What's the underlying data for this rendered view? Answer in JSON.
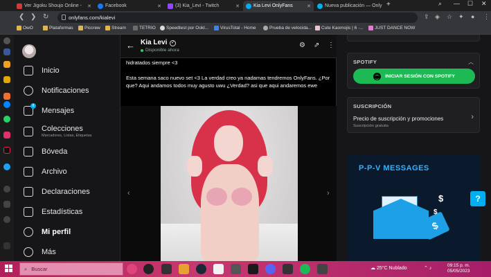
{
  "browser": {
    "tabs": [
      {
        "label": "Ver Jigoku Shoujo Online -",
        "color": "#cf3a3a"
      },
      {
        "label": "Facebook",
        "color": "#1877f2"
      },
      {
        "label": "(3) Kia_Levi - Twitch",
        "color": "#9146ff"
      },
      {
        "label": "Kia Levi OnlyFans",
        "color": "#00aff0",
        "active": true
      },
      {
        "label": "Nueva publicación — Only",
        "color": "#00aff0"
      }
    ],
    "url": "onlyfans.com/kialevi",
    "bookmarks": [
      "OwO",
      "Plataformas",
      "Piccrew",
      "Stream",
      "TETRIO",
      "Speedtest por Ookl...",
      "VirusTotal - Home",
      "Prueba de velocida...",
      "Cute Kaomojis | 6 ·...",
      "JUST DANCE NOW"
    ],
    "new_tab": "+",
    "win_minimize": "—",
    "win_maximize": "☐",
    "win_close": "✕"
  },
  "sidebar": {
    "items": [
      {
        "label": "Inicio",
        "icon": "home-icon"
      },
      {
        "label": "Notificaciones",
        "icon": "bell-icon"
      },
      {
        "label": "Mensajes",
        "icon": "message-icon",
        "badge": "8"
      },
      {
        "label": "Colecciones",
        "sub": "Marcadores, Listas, Etiquetas",
        "icon": "collections-icon"
      },
      {
        "label": "Bóveda",
        "icon": "vault-icon"
      },
      {
        "label": "Archivo",
        "icon": "archive-icon"
      },
      {
        "label": "Declaraciones",
        "icon": "statements-icon"
      },
      {
        "label": "Estadísticas",
        "icon": "stats-icon"
      },
      {
        "label": "Mi perfil",
        "icon": "profile-icon"
      },
      {
        "label": "Más",
        "icon": "more-icon"
      }
    ]
  },
  "chat": {
    "name": "Kia Levi",
    "status": "Disponible ahora",
    "back": "←",
    "message_line1": "hidratados siempre <3",
    "message_line2": "Esta semana saco nuevo set <3 La verdad creo ya nadamas tendremos OnlyFans. ¿Por que? Aqui andamos todos muy agusto uwu ¿Verdad? asi que aqui andaremos ewe",
    "prev": "‹",
    "next": "›"
  },
  "right": {
    "spotify_title": "SPOTIFY",
    "spotify_button": "INICIAR SESIÓN CON SPOTIFY",
    "subscription_title": "SUSCRIPCIÓN",
    "subscription_text": "Precio de suscripción y promociones",
    "subscription_sub": "Suscripción gratuita",
    "ppv_title": "P-P-V  MESSAGES"
  },
  "help": "?",
  "taskbar": {
    "search_placeholder": "Buscar",
    "weather": "25°C  Nublado",
    "time": "09:15 p. m.",
    "date": "05/05/2023"
  }
}
